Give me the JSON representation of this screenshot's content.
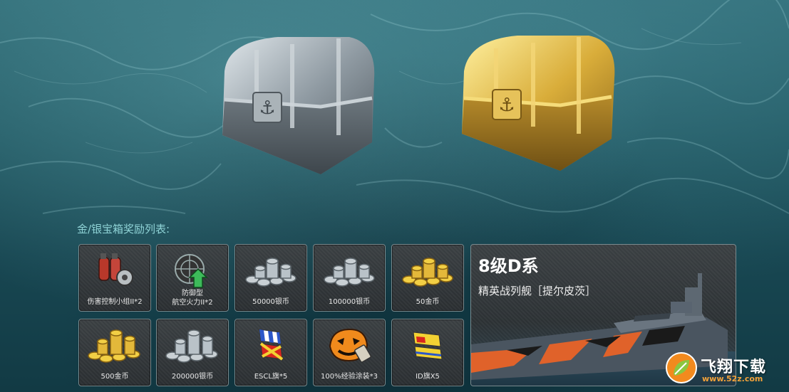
{
  "section_label": "金/银宝箱奖励列表:",
  "rewards": [
    {
      "label": "伤害控制小组II*2",
      "icon": "damage-control-icon"
    },
    {
      "label_line1": "防御型",
      "label_line2": "航空火力II*2",
      "icon": "aa-defense-icon"
    },
    {
      "label": "50000银币",
      "icon": "silver-coins-icon"
    },
    {
      "label": "100000银币",
      "icon": "silver-coins-icon"
    },
    {
      "label": "50金币",
      "icon": "gold-coins-icon"
    },
    {
      "label": "500金币",
      "icon": "gold-coins-icon"
    },
    {
      "label": "200000银币",
      "icon": "silver-coins-icon"
    },
    {
      "label": "ESCL旗*5",
      "icon": "escl-flag-icon"
    },
    {
      "label": "100%经验涂装*3",
      "icon": "camouflage-icon"
    },
    {
      "label": "ID旗X5",
      "icon": "id-flag-icon"
    }
  ],
  "ship": {
    "title": "8级D系",
    "subtitle": "精英战列舰［提尔皮茨］"
  },
  "watermark": {
    "text": "飞翔下载",
    "url": "www.52z.com"
  },
  "colors": {
    "label": "#8fd3d6",
    "silver": "#b9c2c8",
    "gold": "#e3b83a"
  }
}
